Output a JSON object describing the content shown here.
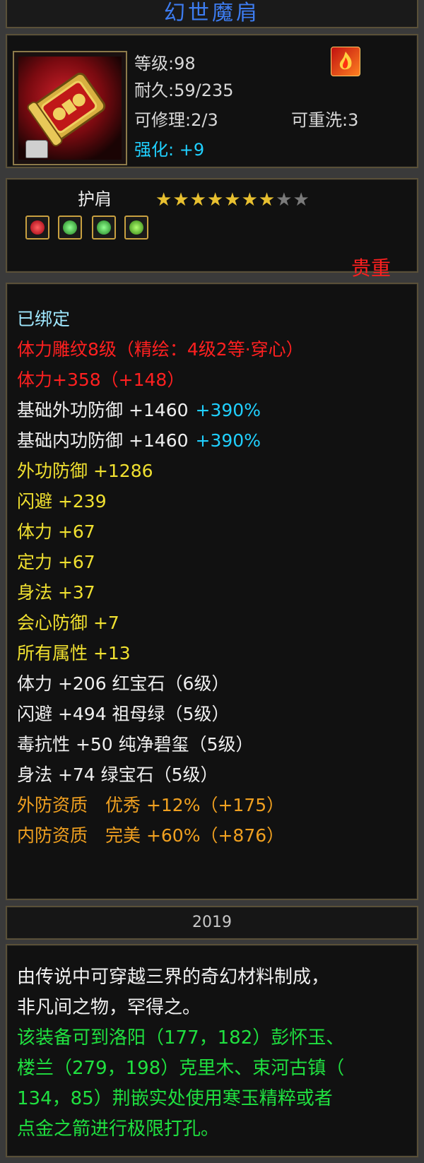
{
  "title": "幻世魔肩",
  "header": {
    "level": "等级:98",
    "durability": "耐久:59/235",
    "repairable": "可修理:2/3",
    "rewashable": "可重洗:3",
    "enhance_label": "强化:",
    "enhance_value": "+9"
  },
  "item": {
    "slot": "护肩",
    "stars_filled": 7,
    "stars_total": 9,
    "rarity": "贵重",
    "gems": [
      "red-gem",
      "green-gem",
      "green-gem",
      "green-gem"
    ]
  },
  "attributes": [
    {
      "text": "已绑定",
      "color": "lightcyan"
    },
    {
      "text": "体力雕纹8级（精绘：4级2等·穿心）",
      "color": "red"
    },
    {
      "text": "体力+358（+148）",
      "color": "red"
    },
    {
      "text": "基础外功防御 +1460",
      "suffix": "+390%",
      "color": "white",
      "suffix_color": "cyan"
    },
    {
      "text": "基础内功防御 +1460",
      "suffix": "+390%",
      "color": "white",
      "suffix_color": "cyan"
    },
    {
      "text": "外功防御 +1286",
      "color": "yellow"
    },
    {
      "text": "闪避 +239",
      "color": "yellow"
    },
    {
      "text": "体力 +67",
      "color": "yellow"
    },
    {
      "text": "定力 +67",
      "color": "yellow"
    },
    {
      "text": "身法 +37",
      "color": "yellow"
    },
    {
      "text": "会心防御 +7",
      "color": "yellow"
    },
    {
      "text": "所有属性 +13",
      "color": "yellow"
    },
    {
      "text": "体力 +206 红宝石（6级）",
      "color": "white"
    },
    {
      "text": "闪避 +494 祖母绿（5级）",
      "color": "white"
    },
    {
      "text": "毒抗性 +50 纯净碧玺（5级）",
      "color": "white"
    },
    {
      "text": "身法 +74 绿宝石（5级）",
      "color": "white"
    },
    {
      "text": "外防资质　优秀 +12%（+175）",
      "color": "orange"
    },
    {
      "text": "内防资质　完美 +60%（+876）",
      "color": "orange"
    }
  ],
  "year": "2019",
  "description": [
    {
      "text": "由传说中可穿越三界的奇幻材料制成，",
      "color": "white"
    },
    {
      "text": "非凡间之物，罕得之。",
      "color": "white"
    },
    {
      "text": "该装备可到洛阳（177，182）彭怀玉、",
      "color": "green"
    },
    {
      "text": "楼兰（279，198）克里木、束河古镇（",
      "color": "green"
    },
    {
      "text": "134，85）荆嵌实处使用寒玉精粹或者",
      "color": "green"
    },
    {
      "text": "点金之箭进行极限打孔。",
      "color": "green"
    }
  ],
  "colors": {
    "frame_border": "#5a5038",
    "panel_bg": "#111111",
    "title_blue": "#3d7cf0",
    "rarity_red": "#ff2020"
  }
}
